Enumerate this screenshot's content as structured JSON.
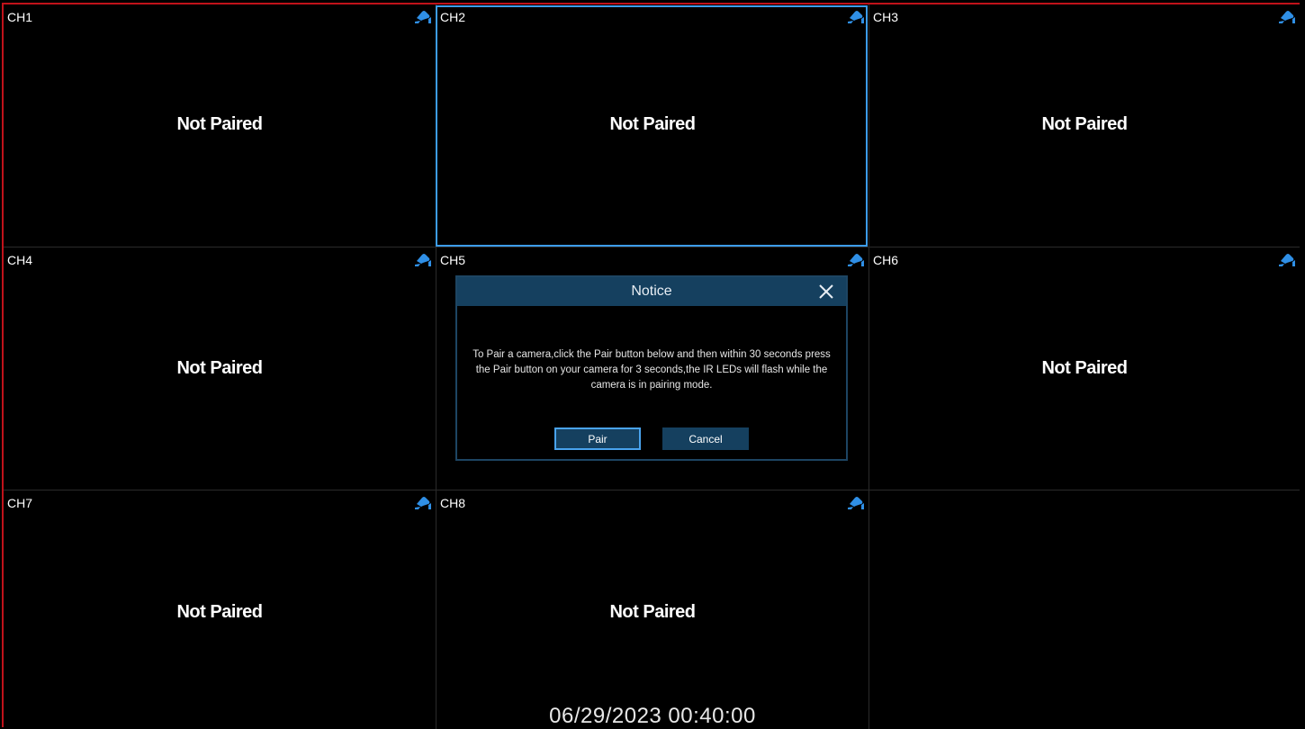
{
  "channels": [
    {
      "label": "CH1",
      "status": "Not Paired"
    },
    {
      "label": "CH2",
      "status": "Not Paired"
    },
    {
      "label": "CH3",
      "status": "Not Paired"
    },
    {
      "label": "CH4",
      "status": "Not Paired"
    },
    {
      "label": "CH5",
      "status": ""
    },
    {
      "label": "CH6",
      "status": "Not Paired"
    },
    {
      "label": "CH7",
      "status": "Not Paired"
    },
    {
      "label": "CH8",
      "status": "Not Paired"
    }
  ],
  "dialog": {
    "title": "Notice",
    "message": "To Pair a camera,click the Pair button below and then within 30 seconds press the Pair button on your camera for 3 seconds,the IR LEDs will flash while the camera is in pairing mode.",
    "pair_label": "Pair",
    "cancel_label": "Cancel"
  },
  "datetime": "06/29/2023 00:40:00",
  "colors": {
    "accent": "#3c9ce8",
    "dialog_header": "#15405f",
    "frame_border": "#c0121a",
    "camera_icon": "#2f8fe6"
  },
  "icons": {
    "camera": "camera-icon",
    "close": "close-icon"
  }
}
